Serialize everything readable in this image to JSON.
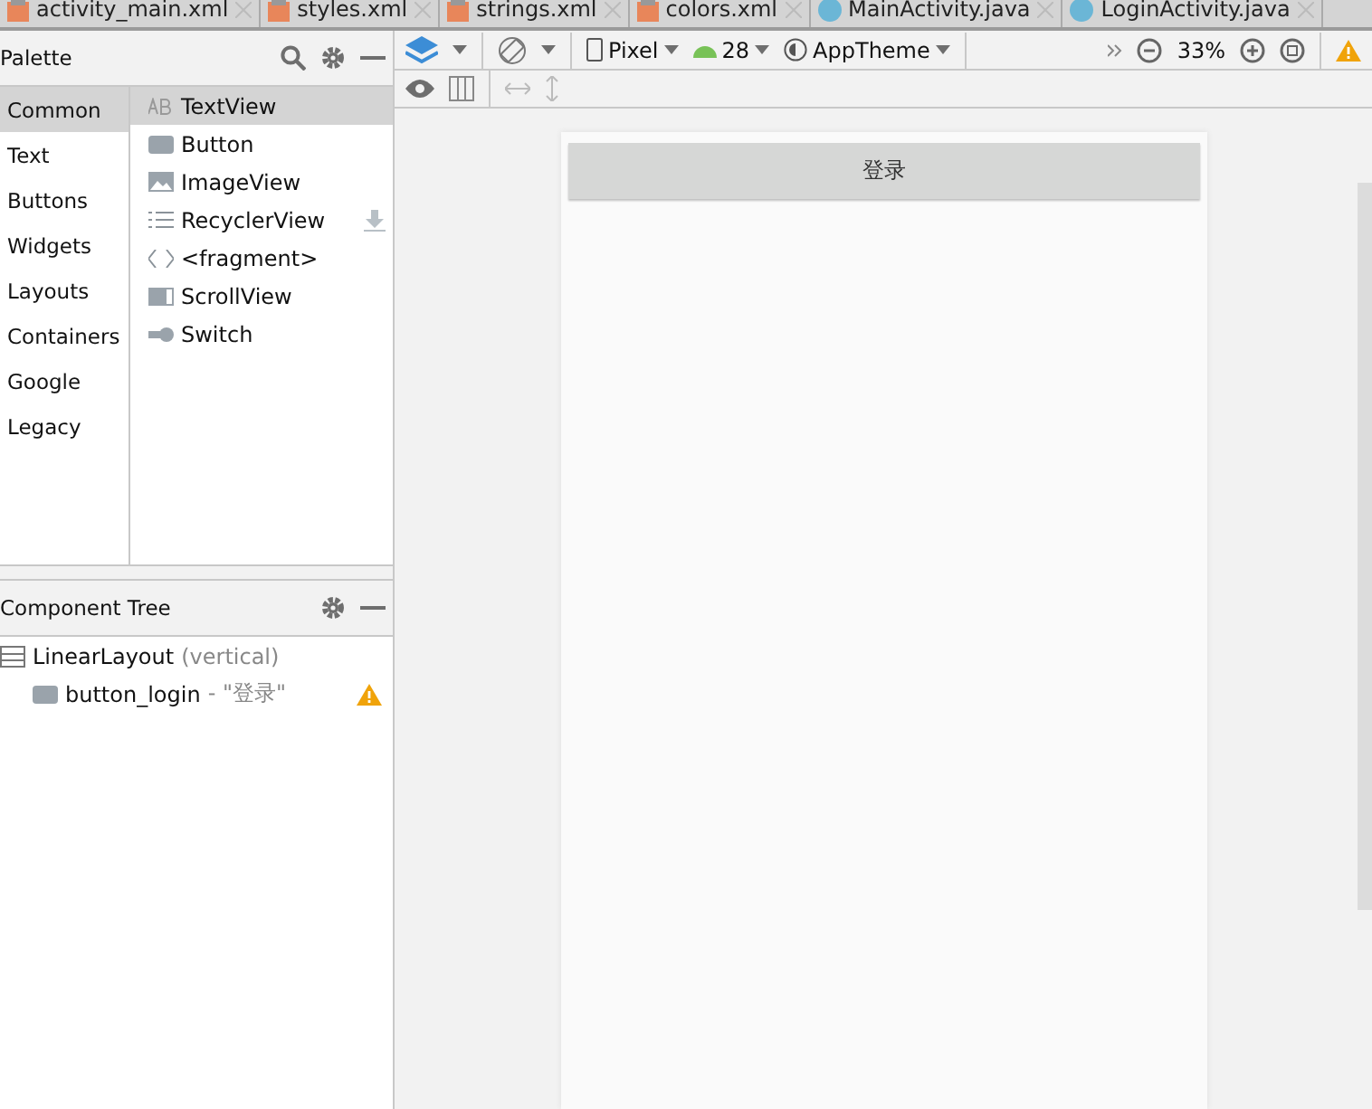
{
  "editor_tabs": [
    {
      "label": "activity_main.xml",
      "kind": "xml"
    },
    {
      "label": "styles.xml",
      "kind": "xml"
    },
    {
      "label": "strings.xml",
      "kind": "xml"
    },
    {
      "label": "colors.xml",
      "kind": "xml"
    },
    {
      "label": "MainActivity.java",
      "kind": "class"
    },
    {
      "label": "LoginActivity.java",
      "kind": "class"
    }
  ],
  "palette": {
    "title": "Palette",
    "categories": [
      {
        "label": "Common",
        "selected": true
      },
      {
        "label": "Text",
        "selected": false
      },
      {
        "label": "Buttons",
        "selected": false
      },
      {
        "label": "Widgets",
        "selected": false
      },
      {
        "label": "Layouts",
        "selected": false
      },
      {
        "label": "Containers",
        "selected": false
      },
      {
        "label": "Google",
        "selected": false
      },
      {
        "label": "Legacy",
        "selected": false
      }
    ],
    "items": [
      {
        "label": "TextView",
        "kind": "text",
        "selected": true,
        "downloadable": false
      },
      {
        "label": "Button",
        "kind": "button",
        "selected": false,
        "downloadable": false
      },
      {
        "label": "ImageView",
        "kind": "image",
        "selected": false,
        "downloadable": false
      },
      {
        "label": "RecyclerView",
        "kind": "list",
        "selected": false,
        "downloadable": true
      },
      {
        "label": "<fragment>",
        "kind": "code",
        "selected": false,
        "downloadable": false
      },
      {
        "label": "ScrollView",
        "kind": "scroll",
        "selected": false,
        "downloadable": false
      },
      {
        "label": "Switch",
        "kind": "switch",
        "selected": false,
        "downloadable": false
      }
    ]
  },
  "component_tree": {
    "title": "Component Tree",
    "nodes": [
      {
        "name": "LinearLayout",
        "detail": "(vertical)",
        "kind": "layout",
        "warning": false,
        "children": [
          {
            "name": "button_login",
            "detail": "- \"登录\"",
            "kind": "button",
            "warning": true
          }
        ]
      }
    ]
  },
  "toolbar": {
    "device": "Pixel",
    "api": "28",
    "theme": "AppTheme",
    "zoom": "33%"
  },
  "preview": {
    "button_label": "登录"
  }
}
